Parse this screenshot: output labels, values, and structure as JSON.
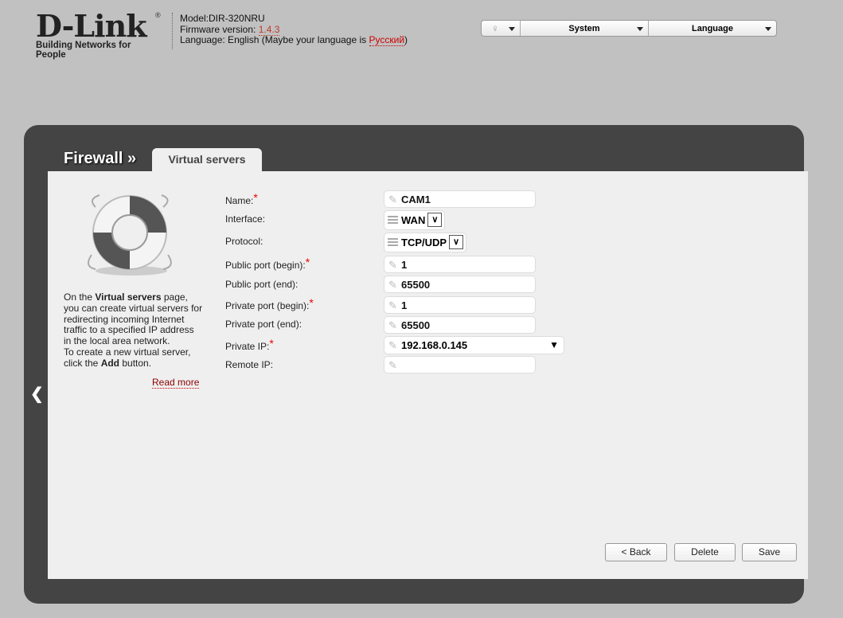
{
  "header": {
    "logo_text": "D-Link",
    "logo_tagline": "Building Networks for People",
    "model": "Model:DIR-320NRU",
    "firmware_label": "Firmware version: ",
    "firmware_version": "1.4.3",
    "language_label": "Language: English (Maybe your language is ",
    "language_suggest": "Русский",
    "language_close": ")"
  },
  "topbar": {
    "system": "System",
    "language": "Language"
  },
  "nav": {
    "breadcrumb": "Firewall »",
    "tab": "Virtual servers"
  },
  "help": {
    "t1": "On the ",
    "b1": "Virtual servers",
    "t2": " page, you can create virtual servers for redirecting incoming Internet traffic to a specified IP address in the local area network.",
    "t3": "To create a new virtual server, click the ",
    "b2": "Add",
    "t4": " button.",
    "read_more": "Read more"
  },
  "form": {
    "name_label": "Name:",
    "name_value": "CAM1",
    "interface_label": "Interface:",
    "interface_value": "WAN",
    "protocol_label": "Protocol:",
    "protocol_value": "TCP/UDP",
    "pub_begin_label": "Public port (begin):",
    "pub_begin_value": "1",
    "pub_end_label": "Public port (end):",
    "pub_end_value": "65500",
    "priv_begin_label": "Private port (begin):",
    "priv_begin_value": "1",
    "priv_end_label": "Private port (end):",
    "priv_end_value": "65500",
    "priv_ip_label": "Private IP:",
    "priv_ip_value": "192.168.0.145",
    "remote_ip_label": "Remote IP:",
    "remote_ip_value": "",
    "required_mark": "*"
  },
  "buttons": {
    "back": "< Back",
    "delete": "Delete",
    "save": "Save"
  }
}
